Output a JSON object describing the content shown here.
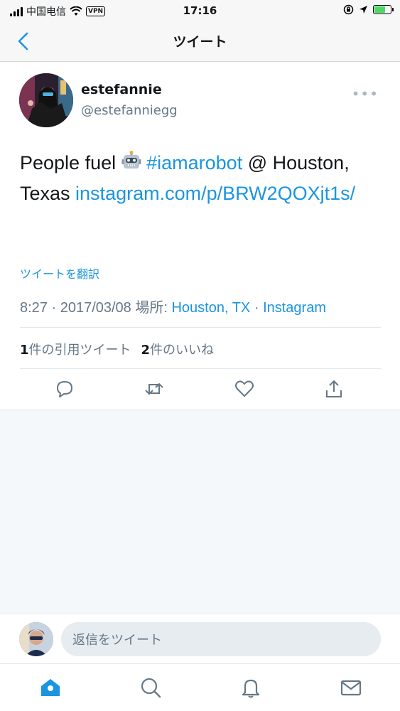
{
  "status_bar": {
    "carrier": "中国电信",
    "vpn": "VPN",
    "time": "17:16"
  },
  "nav": {
    "title": "ツイート"
  },
  "tweet": {
    "display_name": "estefannie",
    "handle": "@estefanniegg",
    "more": "•••",
    "text_before": "People fuel ",
    "hashtag": "#iamarobot",
    "text_mid": " @ Houston, Texas ",
    "url": "instagram.com/p/BRW2QOXjt1s/",
    "translate": "ツイートを翻訳",
    "time": "8:27 · 2017/03/08 場所: ",
    "location": "Houston, TX",
    "separator": " · ",
    "source": "Instagram",
    "quote_count": "1",
    "quote_label": "件の引用ツイート",
    "like_count": "2",
    "like_label": "件のいいね"
  },
  "reply": {
    "placeholder": "返信をツイート"
  },
  "colors": {
    "accent": "#1b95e0",
    "muted": "#657786"
  }
}
